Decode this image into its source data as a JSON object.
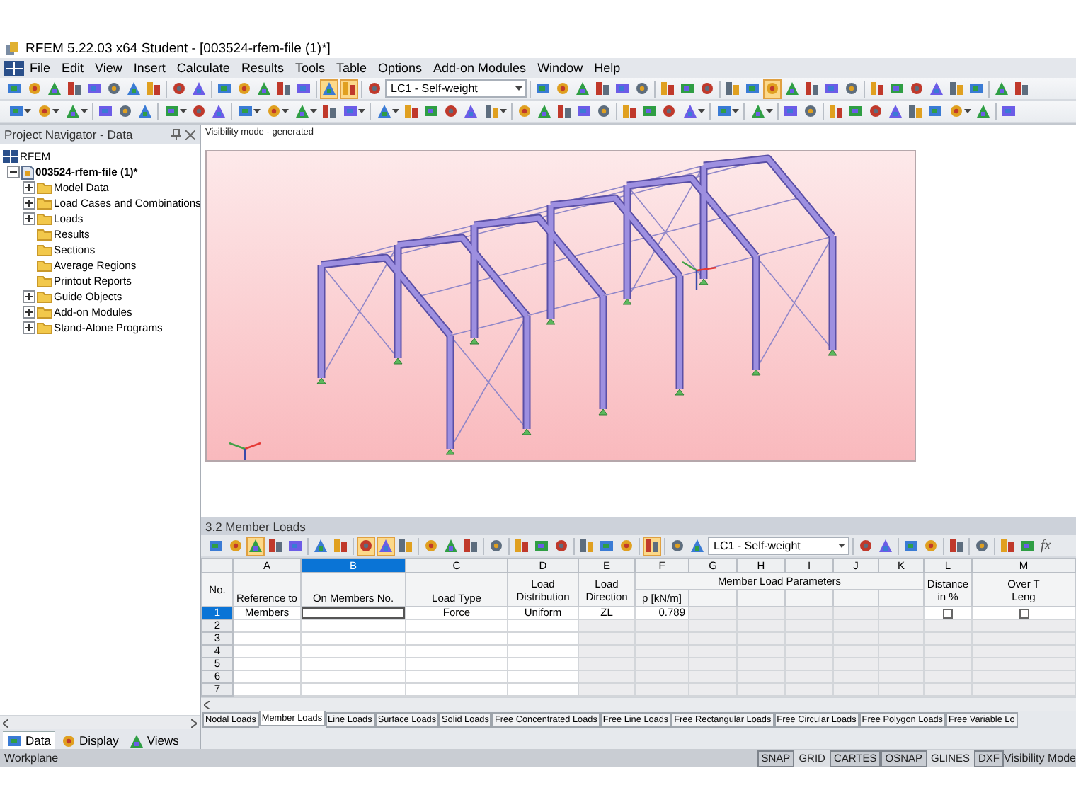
{
  "window": {
    "title": "RFEM 5.22.03 x64 Student - [003524-rfem-file (1)*]"
  },
  "menu": [
    "File",
    "Edit",
    "View",
    "Insert",
    "Calculate",
    "Results",
    "Tools",
    "Table",
    "Options",
    "Add-on Modules",
    "Window",
    "Help"
  ],
  "toolbar_main": [
    {
      "kind": "button",
      "pressed": false
    },
    {
      "kind": "button",
      "pressed": false
    },
    {
      "kind": "button",
      "pressed": false
    },
    {
      "kind": "button",
      "pressed": false
    },
    {
      "kind": "button",
      "pressed": false
    },
    {
      "kind": "button",
      "pressed": false
    },
    {
      "kind": "button",
      "pressed": false
    },
    {
      "kind": "button",
      "pressed": false
    },
    {
      "kind": "separator"
    },
    {
      "kind": "button",
      "pressed": false
    },
    {
      "kind": "button",
      "pressed": false
    },
    {
      "kind": "separator"
    },
    {
      "kind": "button",
      "pressed": false
    },
    {
      "kind": "button",
      "pressed": false
    },
    {
      "kind": "button",
      "pressed": false
    },
    {
      "kind": "button",
      "pressed": false
    },
    {
      "kind": "button",
      "pressed": false
    },
    {
      "kind": "separator"
    },
    {
      "kind": "button",
      "pressed": true
    },
    {
      "kind": "button",
      "pressed": true
    },
    {
      "kind": "separator"
    },
    {
      "kind": "button",
      "pressed": false
    },
    {
      "kind": "combo",
      "value": "LC1 - Self-weight"
    },
    {
      "kind": "separator"
    },
    {
      "kind": "button",
      "pressed": false
    },
    {
      "kind": "button",
      "pressed": false
    },
    {
      "kind": "button",
      "pressed": false
    },
    {
      "kind": "button",
      "pressed": false
    },
    {
      "kind": "button",
      "pressed": false
    },
    {
      "kind": "button",
      "pressed": false
    },
    {
      "kind": "separator"
    },
    {
      "kind": "button",
      "pressed": false
    },
    {
      "kind": "button",
      "pressed": false
    },
    {
      "kind": "button",
      "pressed": false
    },
    {
      "kind": "separator"
    },
    {
      "kind": "button",
      "pressed": false
    },
    {
      "kind": "button",
      "pressed": false
    },
    {
      "kind": "button",
      "pressed": true
    },
    {
      "kind": "button",
      "pressed": false
    },
    {
      "kind": "button",
      "pressed": false
    },
    {
      "kind": "button",
      "pressed": false
    },
    {
      "kind": "button",
      "pressed": false
    },
    {
      "kind": "separator"
    },
    {
      "kind": "button",
      "pressed": false
    },
    {
      "kind": "button",
      "pressed": false
    },
    {
      "kind": "button",
      "pressed": false
    },
    {
      "kind": "button",
      "pressed": false
    },
    {
      "kind": "button",
      "pressed": false
    },
    {
      "kind": "button",
      "pressed": false
    },
    {
      "kind": "separator"
    },
    {
      "kind": "button",
      "pressed": false
    },
    {
      "kind": "button",
      "pressed": false
    }
  ],
  "toolbar_secondary": [
    {
      "kind": "dropdown",
      "pressed": false
    },
    {
      "kind": "dropdown",
      "pressed": false
    },
    {
      "kind": "dropdown",
      "pressed": false
    },
    {
      "kind": "separator"
    },
    {
      "kind": "button",
      "pressed": false
    },
    {
      "kind": "button",
      "pressed": false
    },
    {
      "kind": "button",
      "pressed": false
    },
    {
      "kind": "separator"
    },
    {
      "kind": "dropdown",
      "pressed": false
    },
    {
      "kind": "button",
      "pressed": false
    },
    {
      "kind": "button",
      "pressed": false
    },
    {
      "kind": "separator"
    },
    {
      "kind": "dropdown",
      "pressed": false
    },
    {
      "kind": "dropdown",
      "pressed": false
    },
    {
      "kind": "dropdown",
      "pressed": false
    },
    {
      "kind": "button",
      "pressed": false
    },
    {
      "kind": "dropdown",
      "pressed": false
    },
    {
      "kind": "separator"
    },
    {
      "kind": "dropdown",
      "pressed": false
    },
    {
      "kind": "button",
      "pressed": false
    },
    {
      "kind": "button",
      "pressed": false
    },
    {
      "kind": "button",
      "pressed": false
    },
    {
      "kind": "button",
      "pressed": false
    },
    {
      "kind": "dropdown",
      "pressed": false
    },
    {
      "kind": "separator"
    },
    {
      "kind": "button",
      "pressed": false
    },
    {
      "kind": "button",
      "pressed": false
    },
    {
      "kind": "button",
      "pressed": false
    },
    {
      "kind": "button",
      "pressed": false
    },
    {
      "kind": "button",
      "pressed": false
    },
    {
      "kind": "separator"
    },
    {
      "kind": "button",
      "pressed": false
    },
    {
      "kind": "button",
      "pressed": false
    },
    {
      "kind": "button",
      "pressed": false
    },
    {
      "kind": "dropdown",
      "pressed": false
    },
    {
      "kind": "separator"
    },
    {
      "kind": "dropdown",
      "pressed": false
    },
    {
      "kind": "separator"
    },
    {
      "kind": "dropdown",
      "pressed": false
    },
    {
      "kind": "separator"
    },
    {
      "kind": "button",
      "pressed": false
    },
    {
      "kind": "button",
      "pressed": false
    },
    {
      "kind": "separator"
    },
    {
      "kind": "button",
      "pressed": false
    },
    {
      "kind": "button",
      "pressed": false
    },
    {
      "kind": "button",
      "pressed": false
    },
    {
      "kind": "button",
      "pressed": false
    },
    {
      "kind": "button",
      "pressed": false
    },
    {
      "kind": "button",
      "pressed": false
    },
    {
      "kind": "dropdown",
      "pressed": false
    },
    {
      "kind": "button",
      "pressed": false
    },
    {
      "kind": "separator"
    },
    {
      "kind": "button",
      "pressed": false
    }
  ],
  "navigator": {
    "title": "Project Navigator - Data",
    "root": "RFEM",
    "project": {
      "label": "003524-rfem-file (1)*",
      "expanded": true,
      "children": [
        {
          "label": "Model Data",
          "kind": "collapsed"
        },
        {
          "label": "Load Cases and Combinations",
          "kind": "collapsed"
        },
        {
          "label": "Loads",
          "kind": "collapsed"
        },
        {
          "label": "Results",
          "kind": "leaf"
        },
        {
          "label": "Sections",
          "kind": "leaf"
        },
        {
          "label": "Average Regions",
          "kind": "leaf"
        },
        {
          "label": "Printout Reports",
          "kind": "leaf"
        },
        {
          "label": "Guide Objects",
          "kind": "collapsed"
        },
        {
          "label": "Add-on Modules",
          "kind": "collapsed"
        },
        {
          "label": "Stand-Alone Programs",
          "kind": "collapsed"
        }
      ]
    },
    "tabs": [
      {
        "label": "Data",
        "selected": true
      },
      {
        "label": "Display",
        "selected": false
      },
      {
        "label": "Views",
        "selected": false
      }
    ]
  },
  "viewport": {
    "mode_label": "Visibility mode - generated"
  },
  "table": {
    "title": "3.2 Member Loads",
    "toolbar": [
      {
        "kind": "button",
        "pressed": false
      },
      {
        "kind": "button",
        "pressed": false
      },
      {
        "kind": "button",
        "pressed": true
      },
      {
        "kind": "button",
        "pressed": false
      },
      {
        "kind": "button",
        "pressed": false
      },
      {
        "kind": "separator"
      },
      {
        "kind": "button",
        "pressed": false
      },
      {
        "kind": "button",
        "pressed": false
      },
      {
        "kind": "separator"
      },
      {
        "kind": "button",
        "pressed": true
      },
      {
        "kind": "button",
        "pressed": true
      },
      {
        "kind": "button",
        "pressed": false
      },
      {
        "kind": "separator"
      },
      {
        "kind": "button",
        "pressed": false
      },
      {
        "kind": "button",
        "pressed": false
      },
      {
        "kind": "button",
        "pressed": false
      },
      {
        "kind": "separator"
      },
      {
        "kind": "button",
        "pressed": false
      },
      {
        "kind": "separator"
      },
      {
        "kind": "button",
        "pressed": false
      },
      {
        "kind": "button",
        "pressed": false
      },
      {
        "kind": "button",
        "pressed": false
      },
      {
        "kind": "separator"
      },
      {
        "kind": "button",
        "pressed": false
      },
      {
        "kind": "button",
        "pressed": false
      },
      {
        "kind": "button",
        "pressed": false
      },
      {
        "kind": "separator"
      },
      {
        "kind": "button",
        "pressed": true
      },
      {
        "kind": "separator"
      },
      {
        "kind": "button",
        "pressed": false
      },
      {
        "kind": "button",
        "pressed": false
      },
      {
        "kind": "combo",
        "value": "LC1 - Self-weight"
      },
      {
        "kind": "separator"
      },
      {
        "kind": "button",
        "pressed": false
      },
      {
        "kind": "button",
        "pressed": false
      },
      {
        "kind": "separator"
      },
      {
        "kind": "button",
        "pressed": false
      },
      {
        "kind": "button",
        "pressed": false
      },
      {
        "kind": "separator"
      },
      {
        "kind": "button",
        "pressed": false
      },
      {
        "kind": "separator"
      },
      {
        "kind": "button",
        "pressed": false
      },
      {
        "kind": "separator"
      },
      {
        "kind": "button",
        "pressed": false
      },
      {
        "kind": "button",
        "pressed": false
      },
      {
        "kind": "text",
        "label": "fx"
      }
    ],
    "number_header": "No.",
    "group_header": "Member Load Parameters",
    "columns": [
      {
        "letter": "A",
        "selected": false,
        "kind": "input",
        "bottom": "Reference to"
      },
      {
        "letter": "B",
        "selected": true,
        "kind": "input",
        "bottom": "On Members No."
      },
      {
        "letter": "C",
        "selected": false,
        "kind": "input",
        "bottom": "Load Type"
      },
      {
        "letter": "D",
        "selected": false,
        "kind": "input",
        "top": "Load",
        "bottom": "Distribution"
      },
      {
        "letter": "E",
        "selected": false,
        "kind": "parameter",
        "top": "Load",
        "bottom": "Direction"
      },
      {
        "letter": "F",
        "selected": false,
        "kind": "group",
        "bottom": "p [kN/m]"
      },
      {
        "letter": "G",
        "selected": false,
        "kind": "group"
      },
      {
        "letter": "H",
        "selected": false,
        "kind": "group"
      },
      {
        "letter": "I",
        "selected": false,
        "kind": "group"
      },
      {
        "letter": "J",
        "selected": false,
        "kind": "group"
      },
      {
        "letter": "K",
        "selected": false,
        "kind": "group"
      },
      {
        "letter": "L",
        "selected": false,
        "kind": "check",
        "top": "Distance",
        "bottom": "in %"
      },
      {
        "letter": "M",
        "selected": false,
        "kind": "check",
        "top": "Over T",
        "bottom": "Leng"
      }
    ],
    "rows": [
      {
        "no": "1",
        "selected": true,
        "cells": [
          "Members",
          "",
          "Force",
          "Uniform",
          "ZL",
          "0.789"
        ],
        "checks": [
          false,
          false
        ]
      },
      {
        "no": "2",
        "selected": false
      },
      {
        "no": "3",
        "selected": false
      },
      {
        "no": "4",
        "selected": false
      },
      {
        "no": "5",
        "selected": false
      },
      {
        "no": "6",
        "selected": false
      },
      {
        "no": "7",
        "selected": false
      }
    ],
    "sheet_tabs": [
      {
        "label": "Nodal Loads",
        "selected": false
      },
      {
        "label": "Member Loads",
        "selected": true
      },
      {
        "label": "Line Loads",
        "selected": false
      },
      {
        "label": "Surface Loads",
        "selected": false
      },
      {
        "label": "Solid Loads",
        "selected": false
      },
      {
        "label": "Free Concentrated Loads",
        "selected": false
      },
      {
        "label": "Free Line Loads",
        "selected": false
      },
      {
        "label": "Free Rectangular Loads",
        "selected": false
      },
      {
        "label": "Free Circular Loads",
        "selected": false
      },
      {
        "label": "Free Polygon Loads",
        "selected": false
      },
      {
        "label": "Free Variable Lo",
        "selected": false
      }
    ]
  },
  "status_bar": {
    "left": "Workplane",
    "toggles": [
      {
        "label": "SNAP",
        "on": false
      },
      {
        "label": "GRID",
        "on": true
      },
      {
        "label": "CARTES",
        "on": false
      },
      {
        "label": "OSNAP",
        "on": false
      },
      {
        "label": "GLINES",
        "on": true
      },
      {
        "label": "DXF",
        "on": false
      }
    ],
    "right": "Visibility Mode"
  }
}
